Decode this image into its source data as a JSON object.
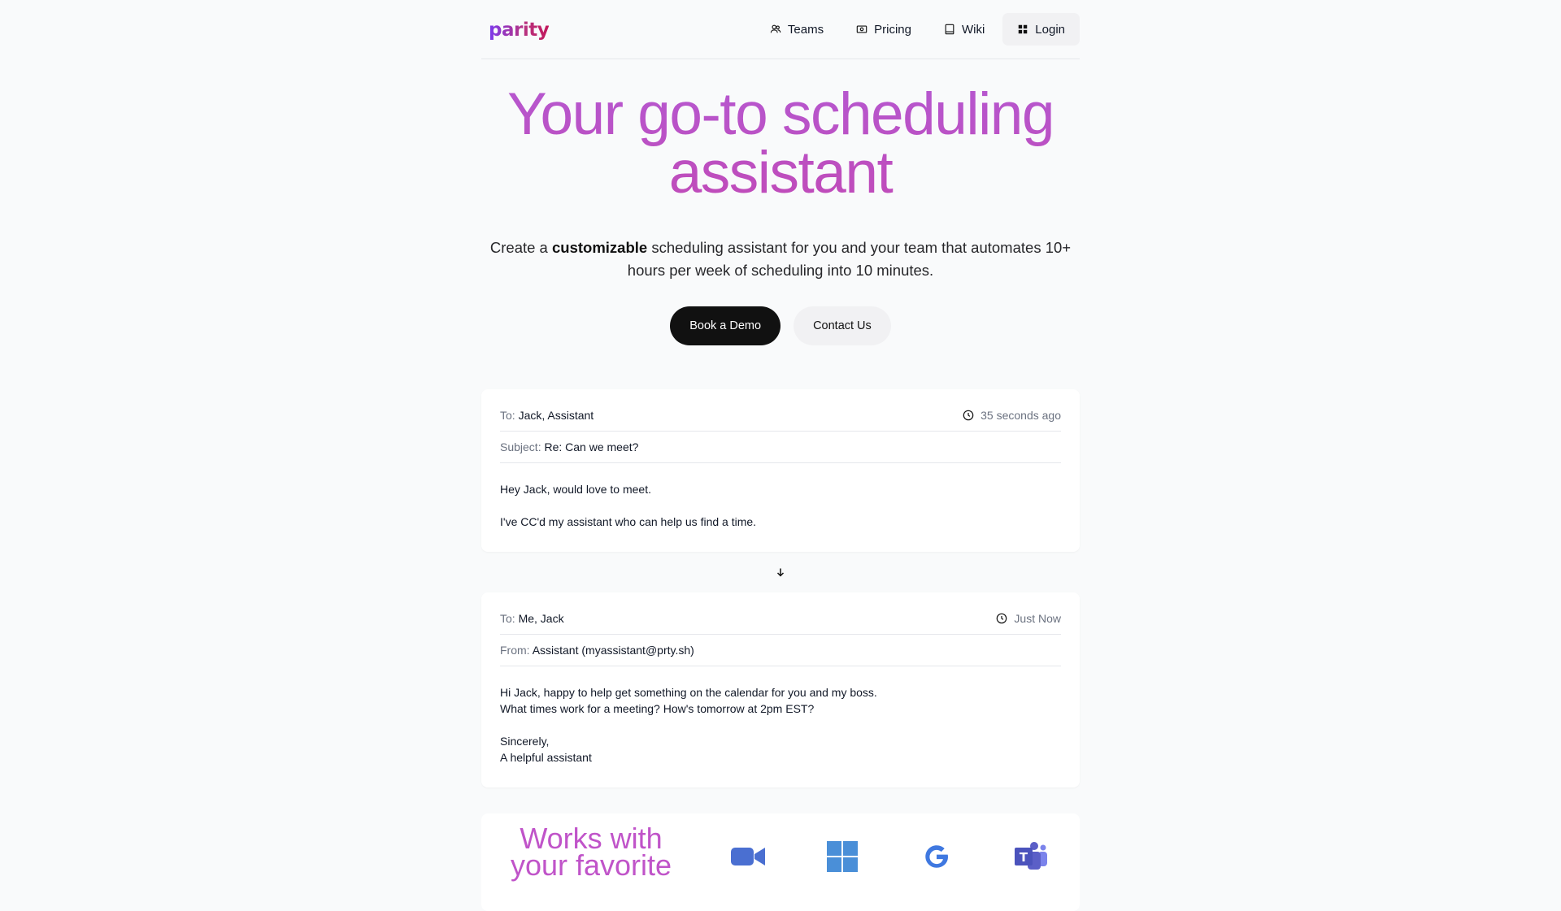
{
  "nav": {
    "logo": "parity",
    "links": [
      {
        "label": "Teams",
        "icon": "users-icon"
      },
      {
        "label": "Pricing",
        "icon": "pricing-tag-icon"
      },
      {
        "label": "Wiki",
        "icon": "book-icon"
      },
      {
        "label": "Login",
        "icon": "grid-icon"
      }
    ]
  },
  "hero": {
    "title_line1": "Your go-to scheduling",
    "title_line2": "assistant",
    "sub_pre": "Create a ",
    "sub_bold": "customizable",
    "sub_post1": " scheduling assistant for you and your team that automates 10+",
    "sub_post2": "hours per week of scheduling into 10 minutes.",
    "primary_cta": "Book a Demo",
    "secondary_cta": "Contact Us"
  },
  "email1": {
    "to_label": "To:",
    "to_value": "Jack, Assistant",
    "time": "35 seconds ago",
    "subject_label": "Subject:",
    "subject_value": "Re: Can we meet?",
    "body": [
      "Hey Jack, would love to meet.",
      "I've CC'd my assistant who can help us find a time."
    ]
  },
  "email2": {
    "to_label": "To:",
    "to_value": "Me, Jack",
    "time": "Just Now",
    "from_label": "From:",
    "from_value": "Assistant (myassistant@prty.sh)",
    "body": [
      "Hi Jack, happy to help get something on the calendar for you and my boss.",
      "What times work for a meeting? How's tomorrow at 2pm EST?",
      "Sincerely,",
      "A helpful assistant"
    ]
  },
  "works": {
    "title_line1": "Works with",
    "title_line2": "your favorite",
    "icons": [
      "zoom-icon",
      "windows-icon",
      "google-icon",
      "teams-icon"
    ],
    "colors": {
      "zoom": "#4a6fd1",
      "windows": "#4a8fd8",
      "google": "#3f78e0",
      "teams": "#5b5fc7"
    }
  }
}
